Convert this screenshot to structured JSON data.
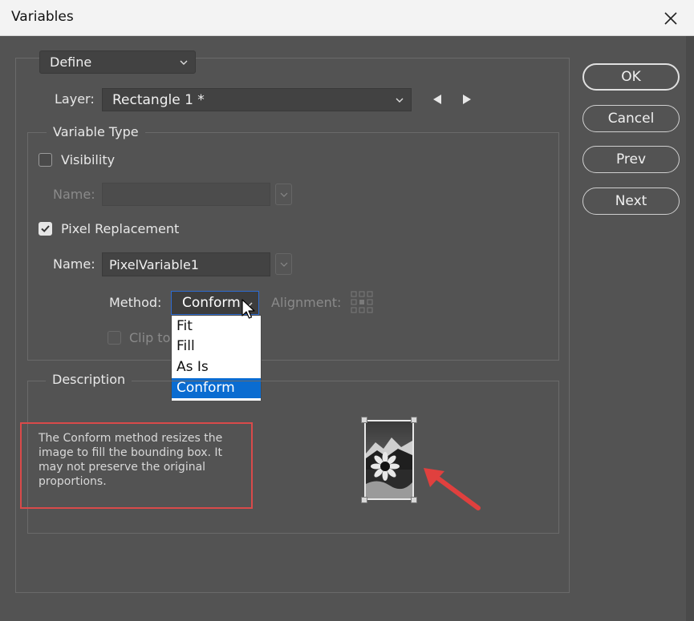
{
  "window": {
    "title": "Variables"
  },
  "mode_select": {
    "value": "Define"
  },
  "layer": {
    "label": "Layer:",
    "value": "Rectangle 1 *"
  },
  "variable_type": {
    "legend": "Variable Type",
    "visibility": {
      "label": "Visibility",
      "checked": false,
      "name_label": "Name:",
      "name_value": ""
    },
    "pixel_replacement": {
      "label": "Pixel Replacement",
      "checked": true,
      "name_label": "Name:",
      "name_value": "PixelVariable1"
    },
    "method": {
      "label": "Method:",
      "value": "Conform",
      "options": [
        "Fit",
        "Fill",
        "As Is",
        "Conform"
      ],
      "selected_option": "Conform"
    },
    "alignment_label": "Alignment:",
    "clip_label": "Clip to"
  },
  "description": {
    "legend": "Description",
    "text": "The Conform method resizes the image to fill the bounding box. It may not preserve the original proportions."
  },
  "buttons": {
    "ok": "OK",
    "cancel": "Cancel",
    "prev": "Prev",
    "next": "Next"
  },
  "colors": {
    "dialog_bg": "#535353",
    "highlight": "#0a6cd1",
    "annotation_red": "#d94a4a"
  },
  "icons": [
    "close-icon",
    "chevron-down-icon",
    "previous-arrow-icon",
    "next-arrow-icon",
    "checkmark-icon",
    "alignment-grid-icon",
    "mouse-cursor-icon",
    "annotation-arrow-icon"
  ]
}
